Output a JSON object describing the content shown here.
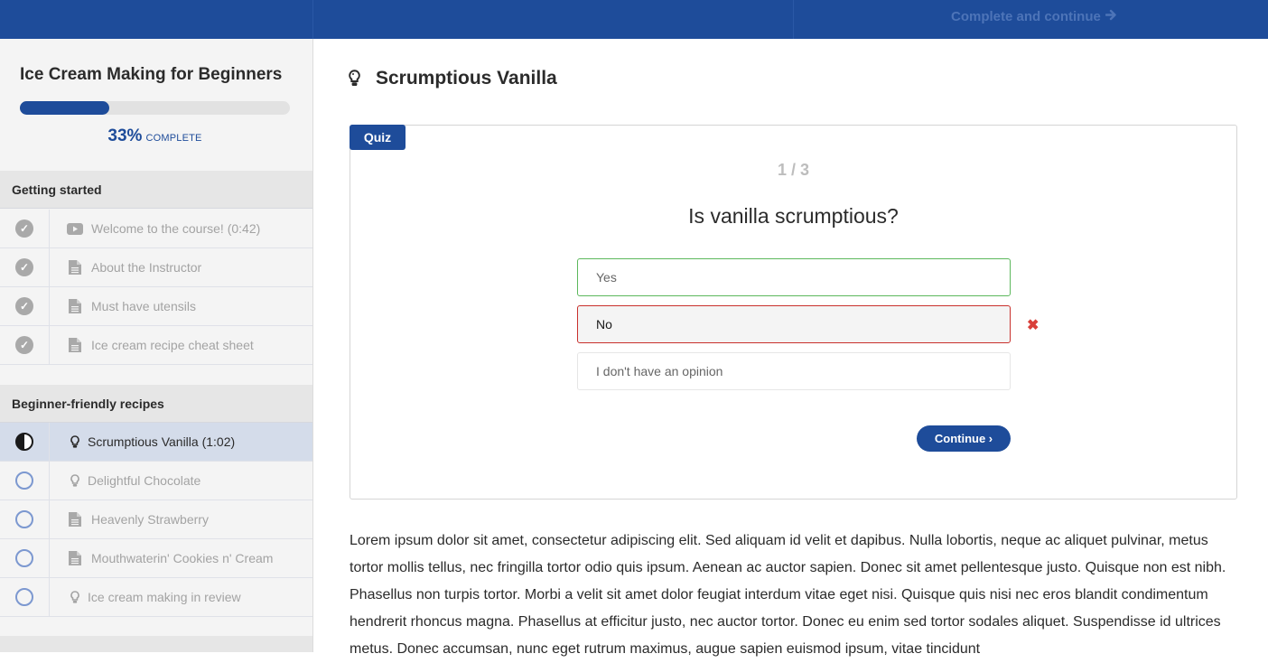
{
  "header": {
    "complete_label": "Complete and continue",
    "complete_icon": "arrow-right-icon",
    "bg_color": "#1e4c9a"
  },
  "sidebar": {
    "course_title": "Ice Cream Making for Beginners",
    "progress": {
      "percent_value": 33,
      "percent_label": "33%",
      "word": "complete"
    },
    "sections": [
      {
        "title": "Getting started",
        "lectures": [
          {
            "title": "Welcome to the course! (0:42)",
            "type": "video",
            "status": "complete"
          },
          {
            "title": "About the Instructor",
            "type": "text",
            "status": "complete"
          },
          {
            "title": "Must have utensils",
            "type": "text",
            "status": "complete"
          },
          {
            "title": "Ice cream recipe cheat sheet",
            "type": "text",
            "status": "complete"
          }
        ]
      },
      {
        "title": "Beginner-friendly recipes",
        "lectures": [
          {
            "title": "Scrumptious Vanilla (1:02)",
            "type": "quiz",
            "status": "in-progress",
            "active": true
          },
          {
            "title": "Delightful Chocolate",
            "type": "quiz",
            "status": "incomplete"
          },
          {
            "title": "Heavenly Strawberry",
            "type": "text",
            "status": "incomplete"
          },
          {
            "title": "Mouthwaterin' Cookies n' Cream",
            "type": "text",
            "status": "incomplete"
          },
          {
            "title": "Ice cream making in review",
            "type": "quiz",
            "status": "incomplete"
          }
        ]
      }
    ]
  },
  "lesson": {
    "title": "Scrumptious Vanilla",
    "icon": "lightbulb-icon"
  },
  "quiz": {
    "tag": "Quiz",
    "counter": "1 / 3",
    "question": "Is vanilla scrumptious?",
    "answers": [
      {
        "label": "Yes",
        "state": "correct"
      },
      {
        "label": "No",
        "state": "selected-wrong"
      },
      {
        "label": "I don't have an opinion",
        "state": "neutral"
      }
    ],
    "wrong_mark": "✖",
    "continue_label": "Continue ›"
  },
  "body_text": "Lorem ipsum dolor sit amet, consectetur adipiscing elit. Sed aliquam id velit et dapibus. Nulla lobortis, neque ac aliquet pulvinar, metus tortor mollis tellus, nec fringilla tortor odio quis ipsum. Aenean ac auctor sapien. Donec sit amet pellentesque justo. Quisque non est nibh. Phasellus non turpis tortor. Morbi a velit sit amet dolor feugiat interdum vitae eget nisi. Quisque quis nisi nec eros blandit condimentum hendrerit rhoncus magna. Phasellus at efficitur justo, nec auctor tortor. Donec eu enim sed tortor sodales aliquet. Suspendisse id ultrices metus. Donec accumsan, nunc eget rutrum maximus, augue sapien euismod ipsum, vitae tincidunt"
}
